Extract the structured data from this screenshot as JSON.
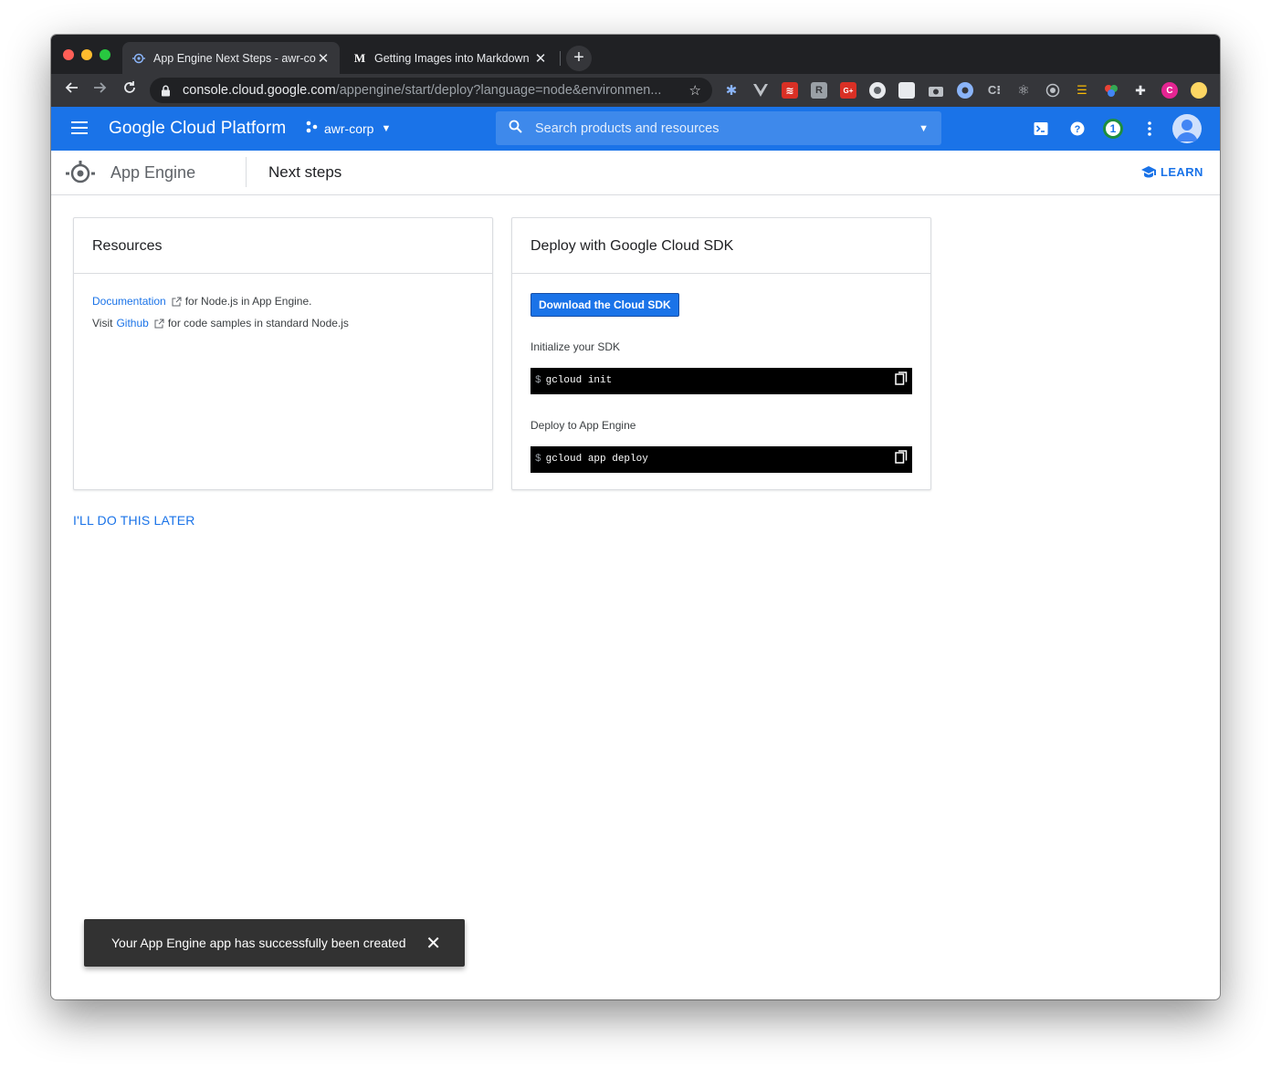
{
  "browser": {
    "tabs": [
      {
        "title": "App Engine Next Steps - awr-corp",
        "active": true
      },
      {
        "title": "Getting Images into Markdown",
        "active": false
      }
    ],
    "new_tab_label": "+",
    "close_glyph": "✕",
    "url_host": "console.cloud.google.com",
    "url_path": "/appengine/start/deploy?language=node&environmen...",
    "profile_initial": "C"
  },
  "gcp": {
    "brand": "Google Cloud Platform",
    "project": "awr-corp",
    "search_placeholder": "Search products and resources",
    "notification_count": "1",
    "accent": "#1a73e8"
  },
  "page": {
    "service": "App Engine",
    "title": "Next steps",
    "learn_label": "LEARN"
  },
  "resources": {
    "title": "Resources",
    "line1_link": "Documentation",
    "line1_text": "for Node.js in App Engine.",
    "line2_prefix": "Visit",
    "line2_link": "Github",
    "line2_text": "for code samples in standard Node.js"
  },
  "deploy": {
    "title": "Deploy with Google Cloud SDK",
    "download_label": "Download the Cloud SDK",
    "init_label": "Initialize your SDK",
    "init_prompt": "$",
    "init_command": "gcloud init",
    "deploy_label": "Deploy to App Engine",
    "deploy_prompt": "$",
    "deploy_command": "gcloud app deploy"
  },
  "later_label": "I'LL DO THIS LATER",
  "snackbar": {
    "message": "Your App Engine app has successfully been created",
    "close_glyph": "✕"
  }
}
